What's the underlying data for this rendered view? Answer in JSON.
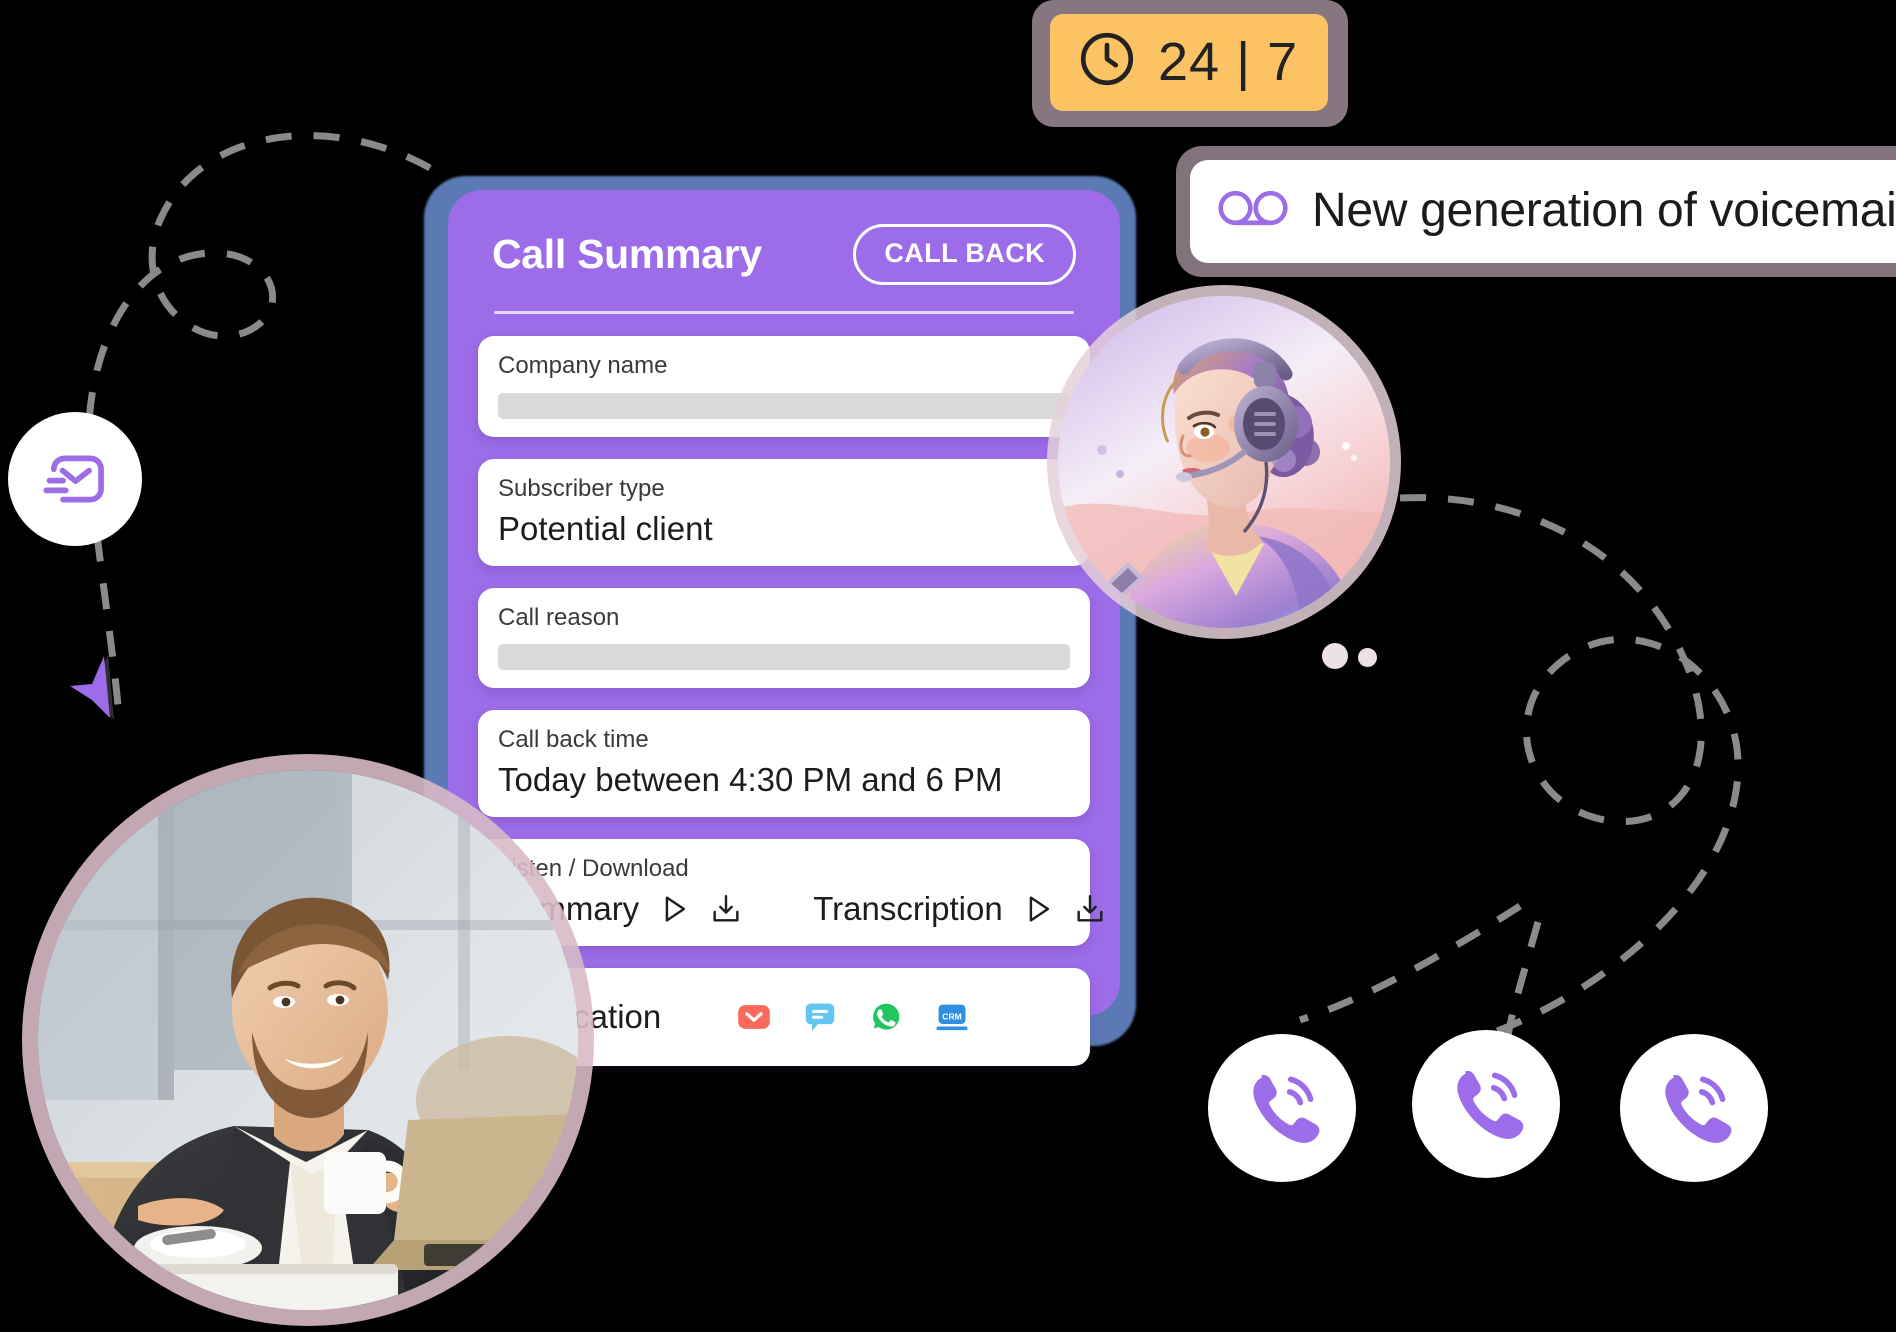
{
  "card": {
    "title": "Call Summary",
    "callback_button": "CALL BACK",
    "fields": [
      {
        "label": "Company name",
        "value": "",
        "kind": "bar"
      },
      {
        "label": "Subscriber type",
        "value": "Potential client",
        "kind": "text"
      },
      {
        "label": "Call reason",
        "value": "",
        "kind": "bar"
      },
      {
        "label": "Call back time",
        "value": "Today between 4:30 PM and 6 PM",
        "kind": "text"
      }
    ],
    "media": {
      "label": "Listen / Download",
      "items": [
        {
          "name": "Summary",
          "play_icon": "play-icon",
          "download_icon": "download-icon"
        },
        {
          "name": "Transcription",
          "play_icon": "play-icon",
          "download_icon": "download-icon"
        }
      ]
    },
    "notification": {
      "label": "Notification",
      "channels": [
        {
          "name": "email-icon",
          "label": "Email",
          "color": "#fa6a5a"
        },
        {
          "name": "sms-icon",
          "label": "SMS",
          "color": "#63c6f0"
        },
        {
          "name": "whatsapp-icon",
          "label": "WhatsApp",
          "color": "#22c55e"
        },
        {
          "name": "crm-icon",
          "label": "CRM",
          "color": "#2f8fe0"
        }
      ]
    }
  },
  "badges": {
    "availability": {
      "text": "24 | 7",
      "icon": "clock-icon",
      "fill": "#fcc365",
      "halo": "#d8becd"
    },
    "voicemail": {
      "text": "New generation of voicemail",
      "icon": "voicemail-icon",
      "accent": "#9d6ce8"
    }
  },
  "decor": {
    "agent_avatar": "call-agent-illustration",
    "customer_avatar": "smiling-businessman-photo",
    "mail_icon": "fast-email-icon",
    "phone_icons": [
      "phone-call-icon",
      "phone-call-icon",
      "phone-call-icon"
    ],
    "cursor": "purple-arrow-cursor"
  },
  "colors": {
    "card_purple": "#9d6ce8",
    "card_backdrop_blue": "#5b7ab5",
    "badge_amber": "#fcc365",
    "halo_pink": "#d8becd",
    "dashed_gray": "#8a8a8a"
  }
}
